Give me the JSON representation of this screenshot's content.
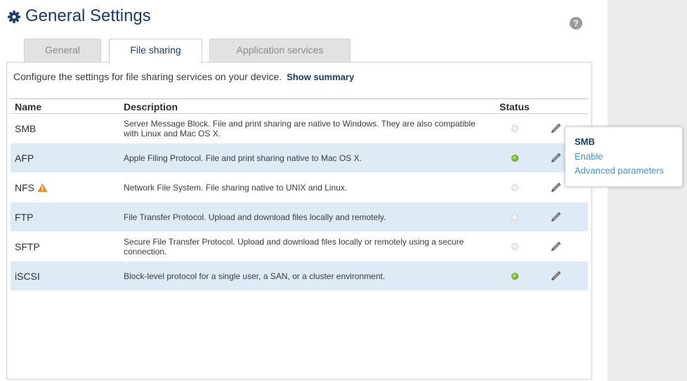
{
  "header": {
    "title": "General Settings"
  },
  "tabs": [
    {
      "label": "General",
      "active": false
    },
    {
      "label": "File sharing",
      "active": true
    },
    {
      "label": "Application services",
      "active": false
    }
  ],
  "panel": {
    "intro": "Configure the settings for file sharing services on your device.",
    "summary_link": "Show summary"
  },
  "table": {
    "headers": {
      "name": "Name",
      "description": "Description",
      "status": "Status"
    },
    "rows": [
      {
        "name": "SMB",
        "description": "Server Message Block. File and print sharing are native to Windows. They are also compatible with Linux and Mac OS X.",
        "status": "off"
      },
      {
        "name": "AFP",
        "description": "Apple Filing Protocol. File and print sharing native to Mac OS X.",
        "status": "on"
      },
      {
        "name": "NFS",
        "description": "Network File System. File sharing native to UNIX and Linux.",
        "status": "off",
        "warning": true
      },
      {
        "name": "FTP",
        "description": "File Transfer Protocol. Upload and download files locally and remotely.",
        "status": "off"
      },
      {
        "name": "SFTP",
        "description": "Secure File Transfer Protocol. Upload and download files locally or remotely using a secure connection.",
        "status": "off"
      },
      {
        "name": "iSCSI",
        "description": "Block-level protocol for a single user, a SAN, or a cluster environment.",
        "status": "on"
      }
    ]
  },
  "popup": {
    "title": "SMB",
    "items": [
      "Enable",
      "Advanced parameters"
    ]
  },
  "colors": {
    "title": "#1c3b66",
    "link": "#4a90c8",
    "row_alt": "#deebf7",
    "status_on": "#5aa21c",
    "warning": "#e8892c",
    "side_panel": "#ececec"
  },
  "icons": {
    "title": "gear-icon",
    "help": "help-icon",
    "edit": "pencil-icon",
    "warning": "warning-icon"
  }
}
